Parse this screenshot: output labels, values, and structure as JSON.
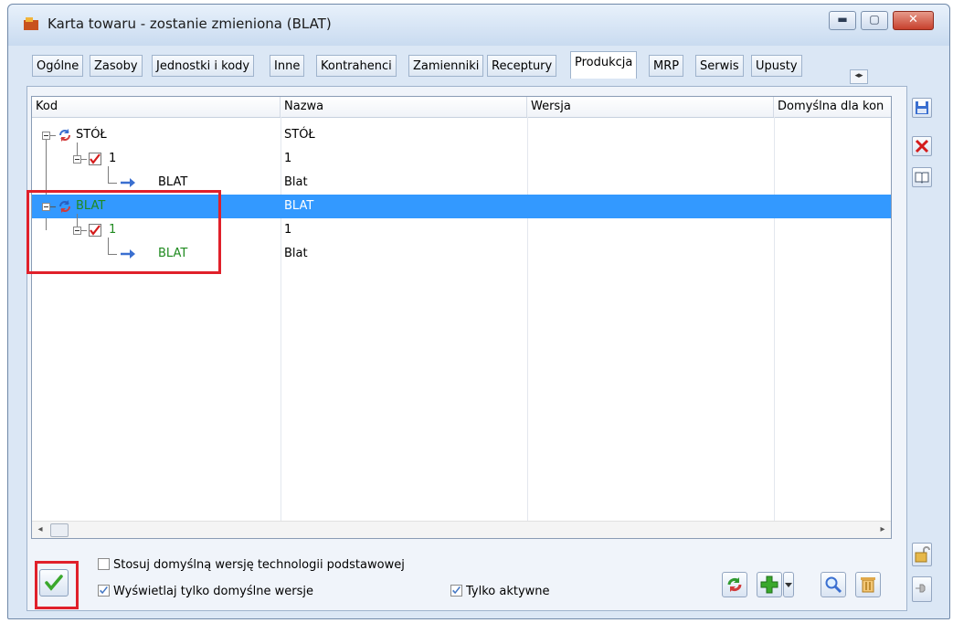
{
  "window": {
    "title": "Karta towaru - zostanie zmieniona (BLAT)",
    "min_glyph": "▬",
    "max_glyph": "▢",
    "close_glyph": "✕"
  },
  "tabs": [
    {
      "label": "Ogólne"
    },
    {
      "label": "Zasoby"
    },
    {
      "label": "Jednostki i kody"
    },
    {
      "label": "Inne"
    },
    {
      "label": "Kontrahenci"
    },
    {
      "label": "Zamienniki"
    },
    {
      "label": "Receptury"
    },
    {
      "label": "Produkcja",
      "active": true
    },
    {
      "label": "MRP"
    },
    {
      "label": "Serwis"
    },
    {
      "label": "Upusty"
    }
  ],
  "tab_scroll": "◂▸",
  "grid": {
    "columns": [
      "Kod",
      "Nazwa",
      "Wersja",
      "Domyślna dla kon"
    ],
    "rows": [
      {
        "kod": "STÓŁ",
        "nazwa": "STÓŁ",
        "level": 0,
        "type": "cycle"
      },
      {
        "kod": "1",
        "nazwa": "1",
        "level": 1,
        "type": "check"
      },
      {
        "kod": "BLAT",
        "nazwa": "Blat",
        "level": 2,
        "type": "arrow"
      },
      {
        "kod": "BLAT",
        "nazwa": "BLAT",
        "level": 0,
        "type": "cycle",
        "selected": true,
        "highlight": "green"
      },
      {
        "kod": "1",
        "nazwa": "1",
        "level": 1,
        "type": "check",
        "highlight": "green"
      },
      {
        "kod": "BLAT",
        "nazwa": "Blat",
        "level": 2,
        "type": "arrow",
        "highlight": "green"
      }
    ],
    "scroll_left": "◂",
    "scroll_right": "▸"
  },
  "options": {
    "default_tech": {
      "label": "Stosuj domyślną wersję technologii podstawowej",
      "checked": false
    },
    "only_default": {
      "label": "Wyświetlaj tylko domyślne wersje",
      "checked": true
    },
    "only_active": {
      "label": "Tylko aktywne",
      "checked": true
    }
  },
  "colors": {
    "selection": "#3399ff",
    "highlight_text": "#1f8a1f",
    "annotation": "#e0202a"
  },
  "icons": [
    "save-icon",
    "delete-icon",
    "book-icon",
    "refresh-icon",
    "add-icon",
    "search-icon",
    "trash-icon",
    "lock-icon",
    "pin-icon",
    "ok-check-icon"
  ]
}
